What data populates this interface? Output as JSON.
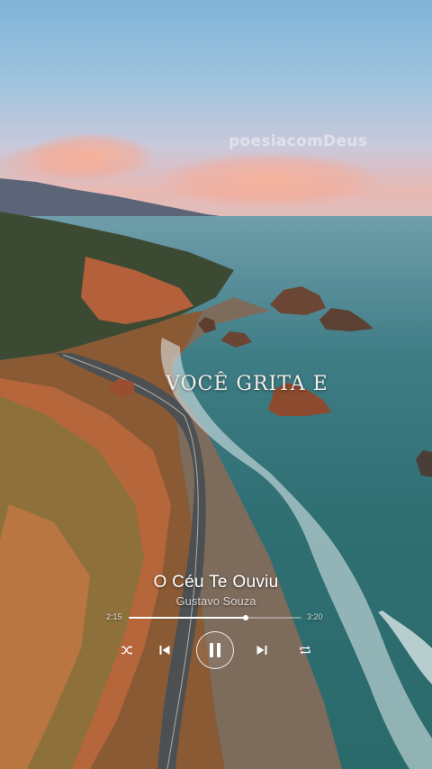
{
  "overlay": {
    "watermark": "poesiacomDeus",
    "lyric": "VOCÊ GRITA E"
  },
  "player": {
    "title": "O Céu Te Ouviu",
    "artist": "Gustavo Souza",
    "elapsed": "2:15",
    "total": "3:20",
    "progress": 0.675,
    "state": "playing",
    "controls": {
      "shuffle": "shuffle-icon",
      "previous": "skip-previous-icon",
      "play_pause": "pause-icon",
      "next": "skip-next-icon",
      "repeat": "repeat-icon"
    }
  }
}
